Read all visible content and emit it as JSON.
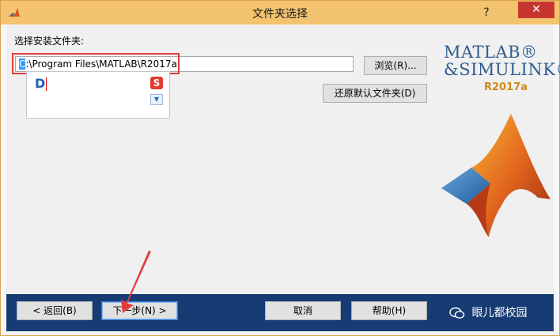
{
  "window": {
    "title": "文件夹选择",
    "help_glyph": "?",
    "close_glyph": "✕"
  },
  "form": {
    "choose_label": "选择安装文件夹:",
    "path_first_char": "C",
    "path_rest": ":\\Program Files\\MATLAB\\R2017a",
    "browse_label": "浏览(R)...",
    "restore_label": "还原默认文件夹(D)"
  },
  "ime": {
    "typed": "D",
    "logo_glyph": "S",
    "dropdown_glyph": "▼"
  },
  "brand": {
    "line1": "MATLAB®",
    "line2": "&SIMULINK®",
    "version": "R2017a"
  },
  "footer": {
    "back_label": "< 返回(B)",
    "next_label": "下一步(N) >",
    "cancel_label": "取消",
    "help_label": "帮助(H)",
    "watermark": " 眼儿都校园"
  },
  "colors": {
    "titlebar": "#f3c36f",
    "footer": "#173c73",
    "highlight": "#e23c3c",
    "brand_blue": "#2f5d91",
    "version_orange": "#d08a18"
  }
}
